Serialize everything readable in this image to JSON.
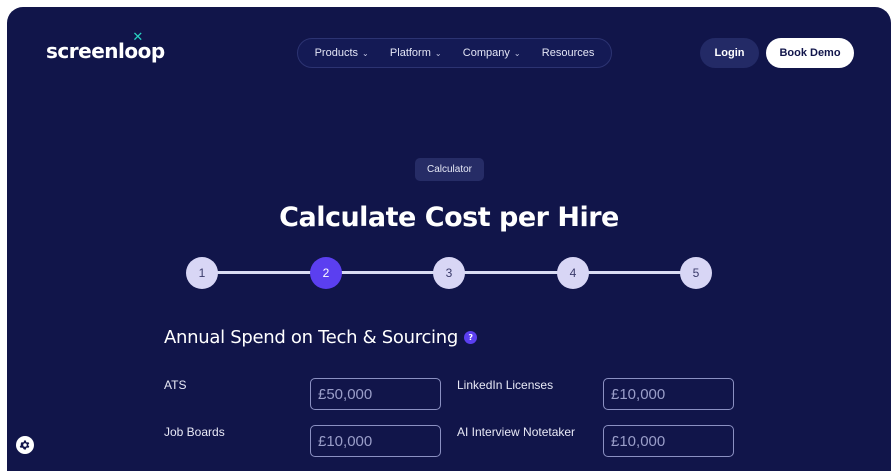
{
  "header": {
    "logo_text_start": "screenl",
    "logo_o1": "o",
    "logo_o2": "o",
    "logo_text_end": "p",
    "nav": [
      {
        "label": "Products",
        "has_menu": true
      },
      {
        "label": "Platform",
        "has_menu": true
      },
      {
        "label": "Company",
        "has_menu": true
      },
      {
        "label": "Resources",
        "has_menu": false
      }
    ],
    "login_label": "Login",
    "demo_label": "Book Demo"
  },
  "hero": {
    "tag": "Calculator",
    "title": "Calculate Cost per Hire"
  },
  "stepper": {
    "steps": [
      "1",
      "2",
      "3",
      "4",
      "5"
    ],
    "active_step": "2"
  },
  "section": {
    "title": "Annual Spend on Tech & Sourcing",
    "help_glyph": "?"
  },
  "fields": {
    "ats_label": "ATS",
    "ats_placeholder": "£50,000",
    "linkedin_label": "LinkedIn Licenses",
    "linkedin_placeholder": "£10,000",
    "job_boards_label": "Job Boards",
    "job_boards_placeholder": "£10,000",
    "ai_notetaker_label": "AI Interview Notetaker",
    "ai_notetaker_placeholder": "£10,000"
  },
  "colors": {
    "background": "#11154a",
    "accent": "#5b3ff0",
    "logo_accent": "#29d3c2",
    "step_inactive": "#d8d6f5"
  },
  "icons": {
    "nav_chevron": "chevron-down-icon",
    "help": "help-icon",
    "cookie": "gear-icon"
  }
}
